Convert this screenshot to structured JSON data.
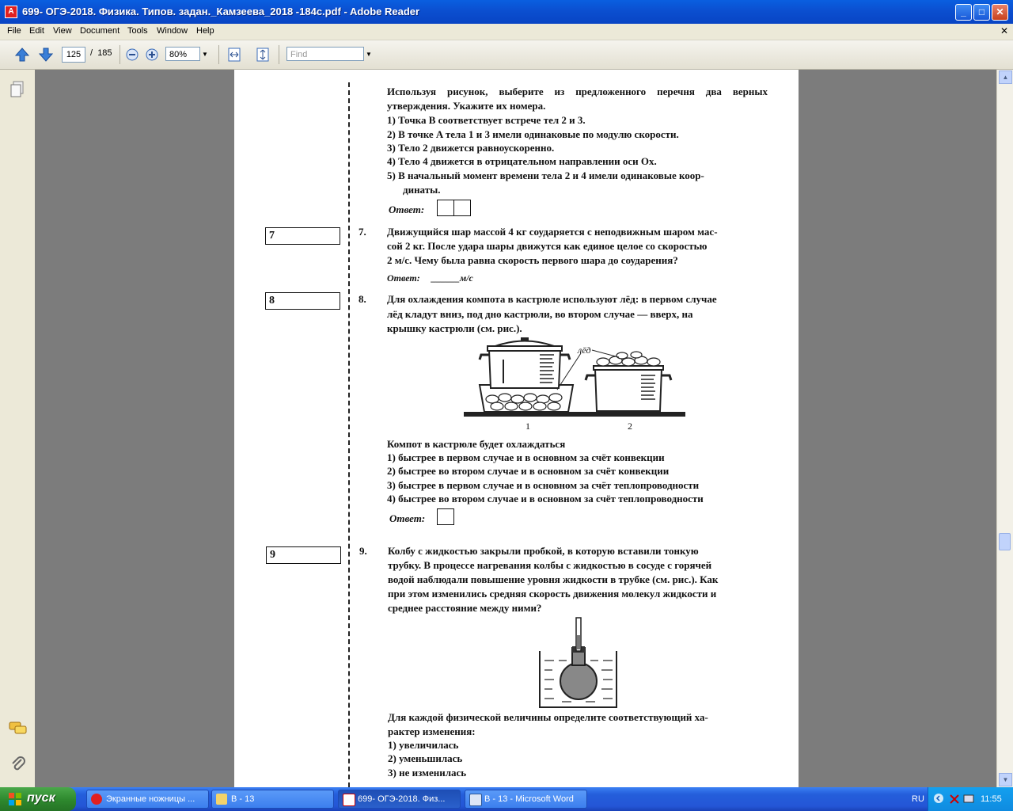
{
  "window": {
    "title": "699- ОГЭ-2018. Физика. Типов. задан._Камзеева_2018 -184с.pdf - Adobe Reader",
    "app_icon": "pdf-icon",
    "buttons": [
      "minimize",
      "maximize",
      "close"
    ]
  },
  "menu": {
    "items": [
      "File",
      "Edit",
      "View",
      "Document",
      "Tools",
      "Window",
      "Help"
    ]
  },
  "toolbar": {
    "page_current": "125",
    "page_sep": "/",
    "page_total": "185",
    "zoom": "80%",
    "find_placeholder": "Find"
  },
  "document": {
    "q6": {
      "intro": "Используя рисунок, выберите из предложенного перечня два верных утверждения. Укажите их номера.",
      "options": [
        "1)  Точка B соответствует встрече тел 2 и 3.",
        "2)  В точке A тела 1 и 3 имели одинаковые по модулю скорости.",
        "3)  Тело 2 движется равноускоренно.",
        "4)  Тело 4 движется в отрицательном направлении оси Ox.",
        "5)  В начальный момент времени тела 2 и 4 имели одинаковые коор-",
        "динаты."
      ],
      "answer_label": "Ответ:"
    },
    "q7": {
      "box": "7",
      "num": "7.",
      "lines": [
        "Движущийся шар массой 4 кг соударяется с неподвижным шаром мас-",
        "сой 2 кг. После удара шары движутся как единое целое со скоростью",
        "2 м/с. Чему была равна скорость первого шара до соударения?"
      ],
      "answer_label": "Ответ:",
      "answer_unit": "______м/с"
    },
    "q8": {
      "box": "8",
      "num": "8.",
      "lines": [
        "Для охлаждения компота в кастрюле используют лёд: в первом случае",
        "лёд  кладут  вниз,  под  дно  кастрюли,  во  втором  случае  —  вверх,  на",
        "крышку кастрюли (см. рис.)."
      ],
      "figure_label_ice": "лёд",
      "figure_label_1": "1",
      "figure_label_2": "2",
      "stem": "Компот в кастрюле будет охлаждаться",
      "options": [
        "1)  быстрее в первом случае и в основном за счёт конвекции",
        "2)  быстрее во втором случае и в основном за счёт конвекции",
        "3)  быстрее в первом случае и в основном за счёт теплопроводности",
        "4)  быстрее во втором случае и в основном за счёт теплопроводности"
      ],
      "answer_label": "Ответ:"
    },
    "q9": {
      "box": "9",
      "num": "9.",
      "lines": [
        "Колбу  с  жидкостью  закрыли  пробкой,  в  которую  вставили  тонкую",
        "трубку. В процессе нагревания колбы с жидкостью в сосуде с горячей",
        "водой наблюдали повышение уровня жидкости в трубке (см. рис.). Как",
        "при этом изменились средняя скорость движения молекул жидкости и",
        "среднее расстояние между ними?"
      ],
      "stem_lines": [
        "Для  каждой  физической  величины  определите  соответствующий  ха-",
        "рактер изменения:"
      ],
      "options": [
        "1)  увеличилась",
        "2)  уменьшилась",
        "3)  не изменилась"
      ]
    }
  },
  "taskbar": {
    "start": "пуск",
    "tasks": [
      {
        "label": "Экранные ножницы ...",
        "icon": "yandex-icon"
      },
      {
        "label": "B - 13",
        "icon": "folder-icon"
      },
      {
        "label": "699- ОГЭ-2018. Физ...",
        "icon": "pdf-icon"
      },
      {
        "label": "B - 13 - Microsoft Word",
        "icon": "word-icon"
      }
    ],
    "lang": "RU",
    "clock": "11:55"
  }
}
